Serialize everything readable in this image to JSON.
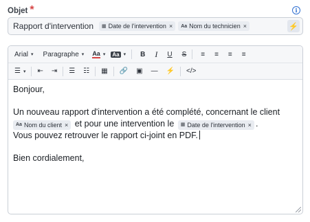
{
  "subject": {
    "label": "Objet",
    "required_mark": "*",
    "text": "Rapport d'intervention",
    "chips": [
      {
        "icon": "calendar-icon",
        "label": "Date de l'intervention",
        "remove": "×"
      },
      {
        "icon": "text-aa-icon",
        "icon_text": "Aa",
        "label": "Nom du technicien",
        "remove": "×"
      }
    ],
    "bolt": "⚡"
  },
  "toolbar": {
    "font_family": "Arial",
    "paragraph": "Paragraphe",
    "caret": "▾",
    "text_color": "Aa",
    "bg_color": "Aa",
    "bold": "B",
    "italic": "I",
    "underline": "U",
    "strike": "S",
    "align_left": "≡",
    "align_center": "≡",
    "align_right": "≡",
    "justify": "≡",
    "list_style": "☰",
    "outdent": "⇤",
    "indent": "⇥",
    "bullets": "☰",
    "numbered": "☷",
    "table": "▦",
    "link": "🔗",
    "image": "▣",
    "hr": "—",
    "bolt": "⚡",
    "code": "</>"
  },
  "body": {
    "line1": "Bonjour,",
    "line2": "Un nouveau rapport d'intervention a été complété, concernant le client",
    "chip_client": {
      "icon_text": "Aa",
      "label": "Nom du client",
      "remove": "×"
    },
    "line3_mid": "et pour une intervention le",
    "chip_date": {
      "label": "Date de l'intervention",
      "remove": "×"
    },
    "line3_end": ".",
    "line4": "Vous pouvez retrouver le rapport ci-joint en PDF.",
    "line5": "Bien cordialement,"
  },
  "colors": {
    "accent": "#2f6fd1",
    "required": "#d64545",
    "chip_bg": "#e9ecf1"
  }
}
